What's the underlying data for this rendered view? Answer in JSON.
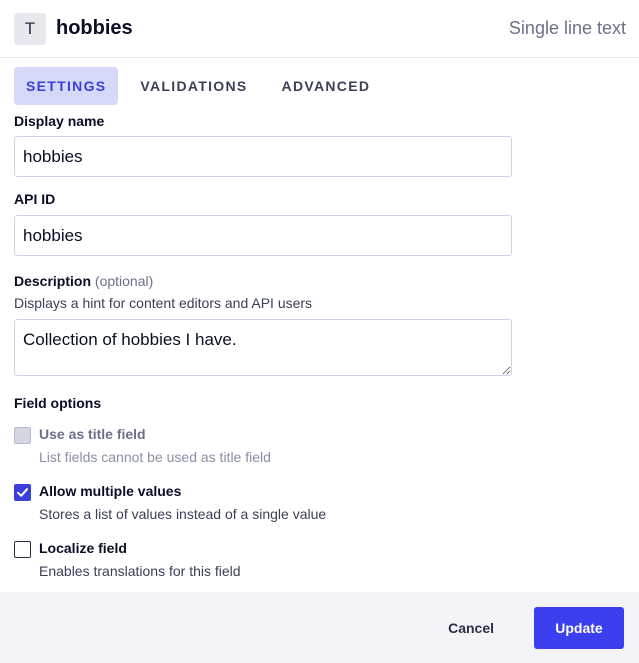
{
  "header": {
    "type_icon_letter": "T",
    "field_name": "hobbies",
    "field_type": "Single line text"
  },
  "tabs": [
    {
      "label": "SETTINGS",
      "active": true
    },
    {
      "label": "VALIDATIONS",
      "active": false
    },
    {
      "label": "ADVANCED",
      "active": false
    }
  ],
  "form": {
    "display_name": {
      "label": "Display name",
      "value": "hobbies"
    },
    "api_id": {
      "label": "API ID",
      "value": "hobbies"
    },
    "description": {
      "label": "Description",
      "optional": "(optional)",
      "hint": "Displays a hint for content editors and API users",
      "value": "Collection of hobbies I have."
    },
    "field_options": {
      "label": "Field options",
      "options": [
        {
          "label": "Use as title field",
          "hint": "List fields cannot be used as title field",
          "checked": false,
          "disabled": true
        },
        {
          "label": "Allow multiple values",
          "hint": "Stores a list of values instead of a single value",
          "checked": true,
          "disabled": false
        },
        {
          "label": "Localize field",
          "hint": "Enables translations for this field",
          "checked": false,
          "disabled": false
        }
      ]
    }
  },
  "footer": {
    "cancel_label": "Cancel",
    "update_label": "Update"
  },
  "colors": {
    "accent": "#3b3ff0",
    "tab_active_bg": "#d6d8f7",
    "footer_bg": "#f3f3f8"
  }
}
